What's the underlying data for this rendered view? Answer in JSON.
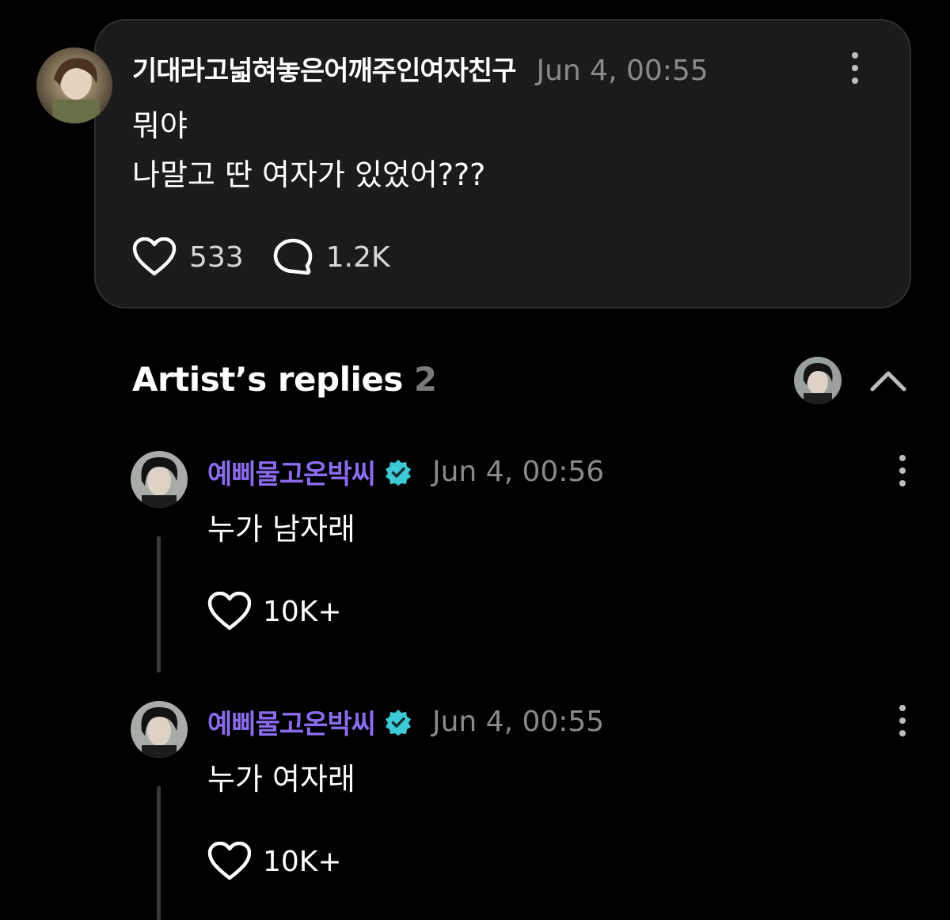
{
  "post": {
    "author": "기대라고넓혀놓은어깨주인여자친구",
    "timestamp": "Jun 4, 00:55",
    "lines": [
      "뭐야",
      "나말고 딴 여자가 있었어???"
    ],
    "likes": "533",
    "comments": "1.2K",
    "icons": {
      "avatar": "user-avatar",
      "like": "heart-icon",
      "comment": "speech-bubble-icon",
      "menu": "more-vertical-icon"
    }
  },
  "artist_replies": {
    "title": "Artist’s replies",
    "count": "2",
    "icons": {
      "avatar": "artist-avatar",
      "collapse": "chevron-up-icon"
    }
  },
  "replies": [
    {
      "author": "예삐물고온박씨",
      "timestamp": "Jun 4, 00:56",
      "text": "누가 남자래",
      "likes": "10K+",
      "verified": true
    },
    {
      "author": "예삐물고온박씨",
      "timestamp": "Jun 4, 00:55",
      "text": "누가 여자래",
      "likes": "10K+",
      "verified": true
    }
  ],
  "colors": {
    "background": "#000000",
    "card": "#1b1b1b",
    "artist_name": "#8b6cf0",
    "verified_badge": "#3ec9d6",
    "muted": "#8a8a8a"
  }
}
